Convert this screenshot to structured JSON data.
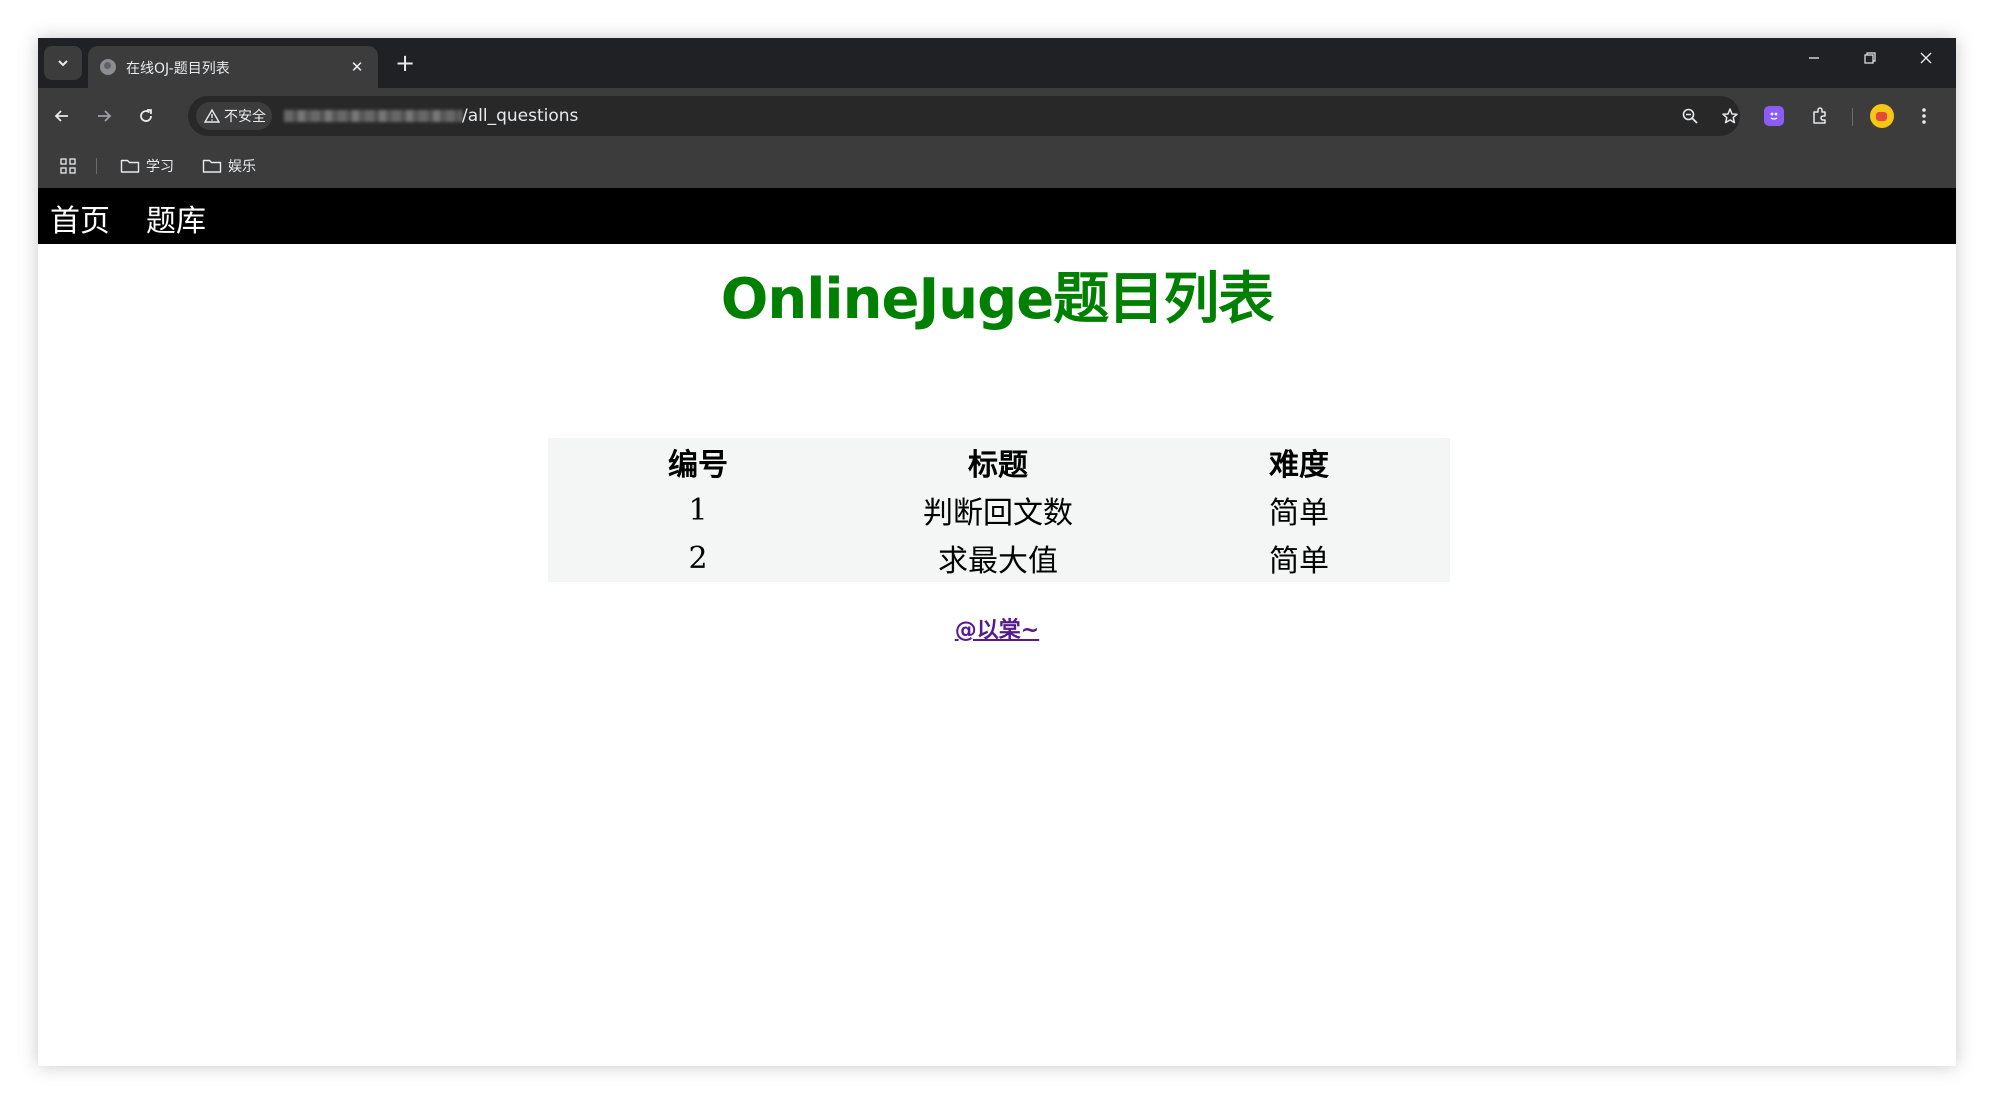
{
  "browser": {
    "tab": {
      "title": "在线OJ-题目列表",
      "close_label": "✕"
    },
    "new_tab_label": "+",
    "window_controls": {
      "minimize": "─",
      "restore": "❐",
      "close": "✕"
    },
    "omnibox": {
      "security_label": "不安全",
      "url_path": "/all_questions"
    },
    "bookmarks": [
      {
        "label": "学习"
      },
      {
        "label": "娱乐"
      }
    ]
  },
  "page": {
    "nav": [
      {
        "label": "首页"
      },
      {
        "label": "题库"
      }
    ],
    "title": "OnlineJuge题目列表",
    "table": {
      "headers": [
        "编号",
        "标题",
        "难度"
      ],
      "rows": [
        [
          "1",
          "判断回文数",
          "简单"
        ],
        [
          "2",
          "求最大值",
          "简单"
        ]
      ]
    },
    "footer_link": "@以棠~"
  },
  "colors": {
    "title_green": "#008000",
    "nav_bg": "#000000",
    "table_bg": "#f3f6f5",
    "link_visited": "#551a8b",
    "chrome_dark": "#202124",
    "chrome_toolbar": "#3c3c3c"
  }
}
